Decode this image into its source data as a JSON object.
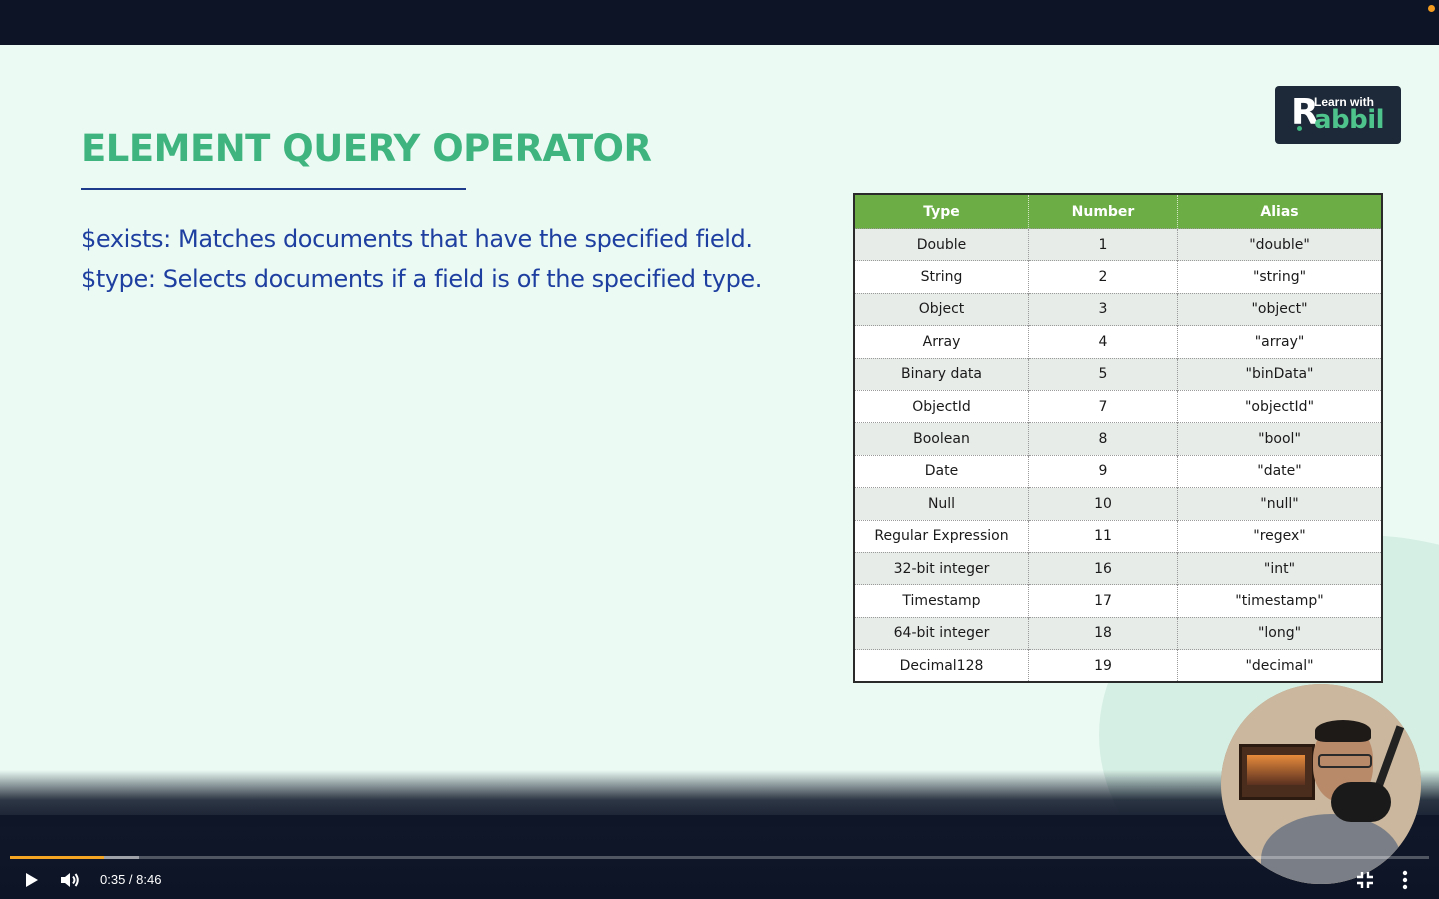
{
  "slide": {
    "title": "ELEMENT QUERY OPERATOR",
    "lines": [
      "$exists: Matches documents that have the specified field.",
      "$type: Selects documents if a field is of the specified type."
    ],
    "logo": {
      "mark": "R",
      "top": "Learn with",
      "main": "abbil"
    }
  },
  "table": {
    "headers": [
      "Type",
      "Number",
      "Alias"
    ],
    "rows": [
      [
        "Double",
        "1",
        "\"double\""
      ],
      [
        "String",
        "2",
        "\"string\""
      ],
      [
        "Object",
        "3",
        "\"object\""
      ],
      [
        "Array",
        "4",
        "\"array\""
      ],
      [
        "Binary data",
        "5",
        "\"binData\""
      ],
      [
        "ObjectId",
        "7",
        "\"objectId\""
      ],
      [
        "Boolean",
        "8",
        "\"bool\""
      ],
      [
        "Date",
        "9",
        "\"date\""
      ],
      [
        "Null",
        "10",
        "\"null\""
      ],
      [
        "Regular Expression",
        "11",
        "\"regex\""
      ],
      [
        "32-bit integer",
        "16",
        "\"int\""
      ],
      [
        "Timestamp",
        "17",
        "\"timestamp\""
      ],
      [
        "64-bit integer",
        "18",
        "\"long\""
      ],
      [
        "Decimal128",
        "19",
        "\"decimal\""
      ]
    ]
  },
  "player": {
    "time": "0:35 / 8:46",
    "played_fraction": 0.066,
    "buffered_fraction": 0.091,
    "icons": {
      "play": "play-icon",
      "volume": "volume-icon",
      "fullscreen": "exit-fullscreen-icon",
      "more": "more-vertical-icon"
    },
    "accent": "#f5a623"
  },
  "colors": {
    "title": "#3fb47e",
    "body_text": "#1f3fa0",
    "table_header": "#6cad45",
    "slide_bg": "#ebfbf4"
  }
}
